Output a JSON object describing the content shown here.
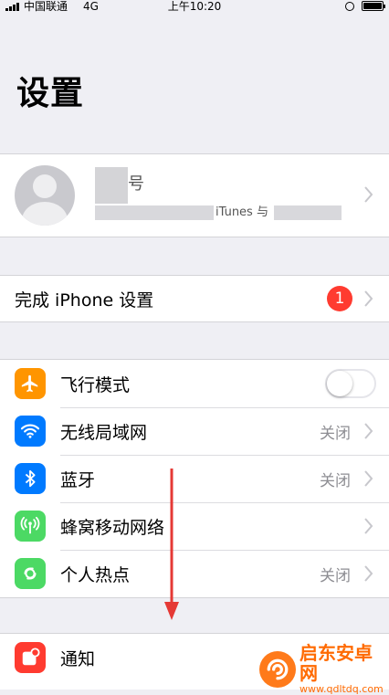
{
  "status_bar": {
    "carrier": "中国联通",
    "network": "4G",
    "time": "上午10:20"
  },
  "page": {
    "title": "设置"
  },
  "profile": {
    "name_partial": "号",
    "subtitle_partial": "iTunes 与"
  },
  "setup": {
    "label": "完成 iPhone 设置",
    "badge_count": "1"
  },
  "network_group": {
    "items": [
      {
        "label": "飞行模式",
        "icon": "airplane-icon",
        "color": "#ff9500",
        "toggle_on": false
      },
      {
        "label": "无线局域网",
        "value": "关闭",
        "icon": "wifi-icon",
        "color": "#007aff"
      },
      {
        "label": "蓝牙",
        "value": "关闭",
        "icon": "bluetooth-icon",
        "color": "#007aff"
      },
      {
        "label": "蜂窝移动网络",
        "value": "",
        "icon": "cellular-icon",
        "color": "#4cd964"
      },
      {
        "label": "个人热点",
        "value": "关闭",
        "icon": "hotspot-icon",
        "color": "#4cd964"
      }
    ]
  },
  "notify_group": {
    "items": [
      {
        "label": "通知",
        "icon": "notification-icon",
        "color": "#ff3b30"
      }
    ]
  },
  "watermark": {
    "title": "启东安卓网",
    "url": "www.qdltdq.com"
  }
}
